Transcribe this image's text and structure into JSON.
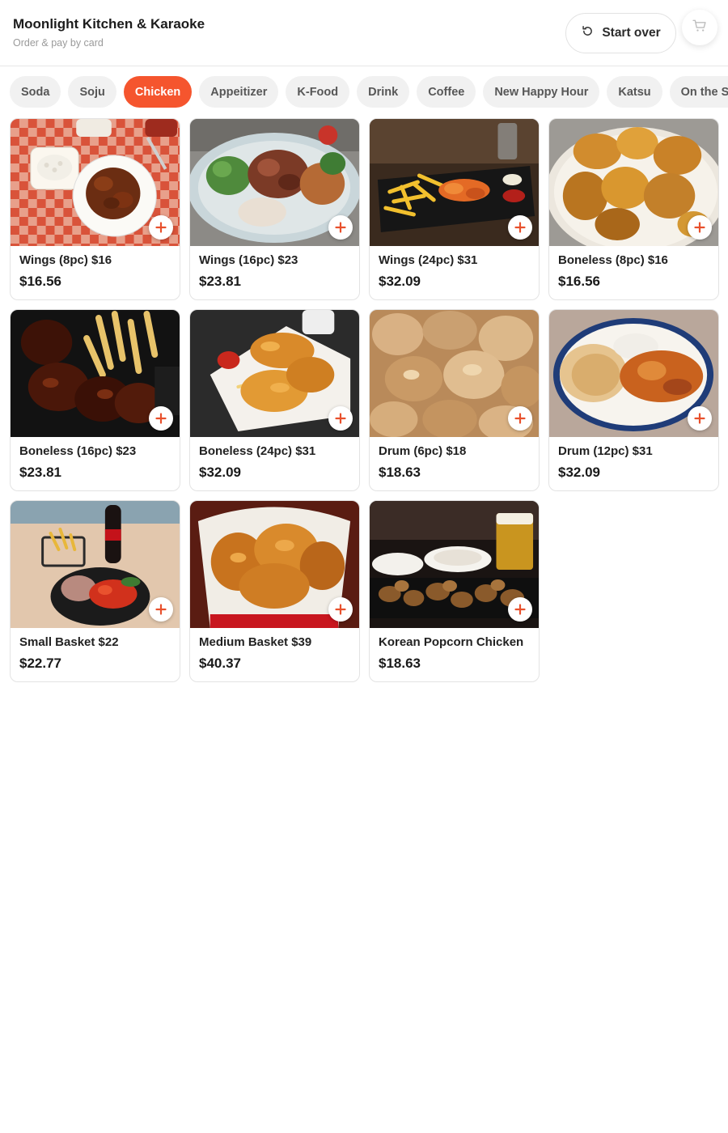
{
  "header": {
    "title": "Moonlight Kitchen & Karaoke",
    "subtitle": "Order & pay by card",
    "start_over_label": "Start over",
    "cart_icon": "cart-icon"
  },
  "tabs": [
    {
      "label": "Soda",
      "active": false
    },
    {
      "label": "Soju",
      "active": false
    },
    {
      "label": "Chicken",
      "active": true
    },
    {
      "label": "Appeitizer",
      "active": false
    },
    {
      "label": "K-Food",
      "active": false
    },
    {
      "label": "Drink",
      "active": false
    },
    {
      "label": "Coffee",
      "active": false
    },
    {
      "label": "New Happy Hour",
      "active": false
    },
    {
      "label": "Katsu",
      "active": false
    },
    {
      "label": "On the Side",
      "active": false
    }
  ],
  "items": [
    {
      "name": "Wings (8pc) $16",
      "price": "$16.56",
      "photo": "checker"
    },
    {
      "name": "Wings (16pc) $23",
      "price": "$23.81",
      "photo": "platter"
    },
    {
      "name": "Wings (24pc) $31",
      "price": "$32.09",
      "photo": "fries-tray"
    },
    {
      "name": "Boneless (8pc) $16",
      "price": "$16.56",
      "photo": "nuggets"
    },
    {
      "name": "Boneless (16pc) $23",
      "price": "$23.81",
      "photo": "glazed"
    },
    {
      "name": "Boneless (24pc) $31",
      "price": "$32.09",
      "photo": "tenders"
    },
    {
      "name": "Drum (6pc) $18",
      "price": "$18.63",
      "photo": "fried-pile"
    },
    {
      "name": "Drum (12pc) $31",
      "price": "$32.09",
      "photo": "roast"
    },
    {
      "name": "Small Basket $22",
      "price": "$22.77",
      "photo": "basket-plate"
    },
    {
      "name": "Medium Basket $39",
      "price": "$40.37",
      "photo": "bucket"
    },
    {
      "name": "Korean Popcorn Chicken",
      "price": "$18.63",
      "photo": "popcorn"
    }
  ],
  "colors": {
    "accent": "#f5552e",
    "tab_bg": "#f1f1f1",
    "border": "#e3e3e3"
  }
}
